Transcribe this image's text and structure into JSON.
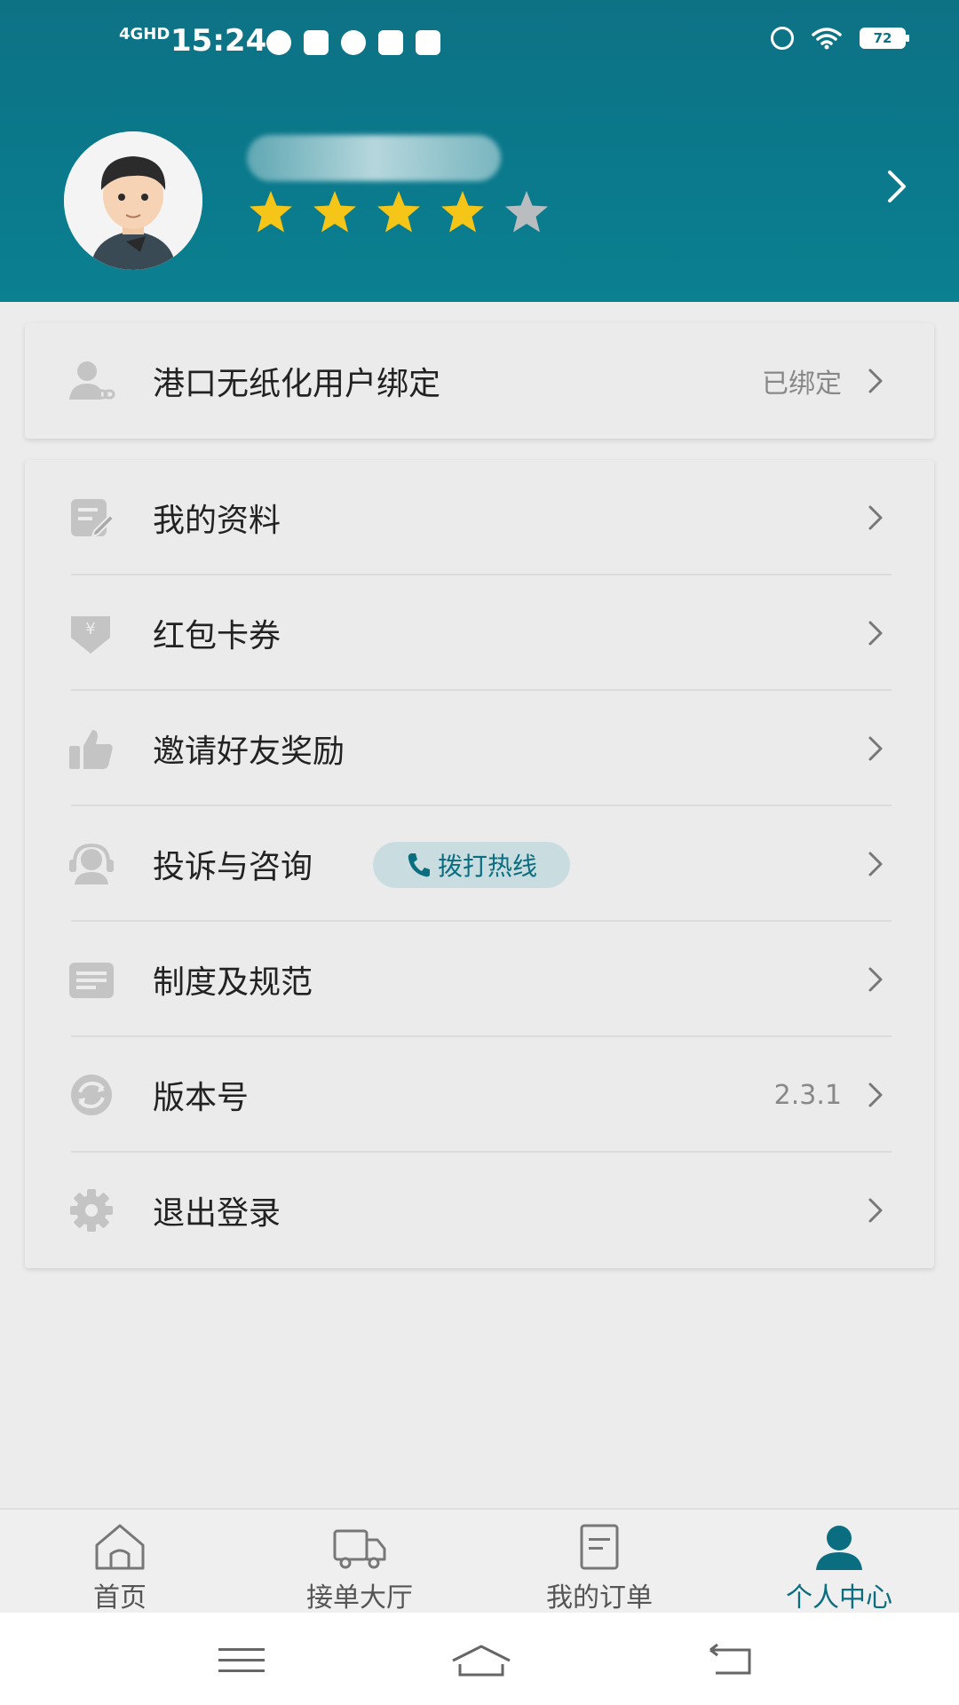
{
  "status_bar": {
    "signal": "4GHD",
    "time": "15:24",
    "battery": "72"
  },
  "profile": {
    "rating": 4,
    "rating_max": 5,
    "star_color": "#f5c518",
    "star_empty_color": "#b9bdc0"
  },
  "binding": {
    "label": "港口无纸化用户绑定",
    "status": "已绑定"
  },
  "menu": [
    {
      "label": "我的资料",
      "icon": "profile-edit-icon"
    },
    {
      "label": "红包卡券",
      "icon": "coupon-icon"
    },
    {
      "label": "邀请好友奖励",
      "icon": "thumbs-up-icon"
    },
    {
      "label": "投诉与咨询",
      "icon": "headset-icon",
      "badge": "拨打热线"
    },
    {
      "label": "制度及规范",
      "icon": "document-icon"
    },
    {
      "label": "版本号",
      "icon": "refresh-icon",
      "value": "2.3.1"
    },
    {
      "label": "退出登录",
      "icon": "gear-icon"
    }
  ],
  "tabs": [
    {
      "label": "首页",
      "icon": "home-icon"
    },
    {
      "label": "接单大厅",
      "icon": "truck-icon"
    },
    {
      "label": "我的订单",
      "icon": "order-icon"
    },
    {
      "label": "个人中心",
      "icon": "user-icon",
      "active": true
    }
  ],
  "colors": {
    "header": "#0e7285",
    "accent": "#0a6d80",
    "background": "#ececec"
  }
}
